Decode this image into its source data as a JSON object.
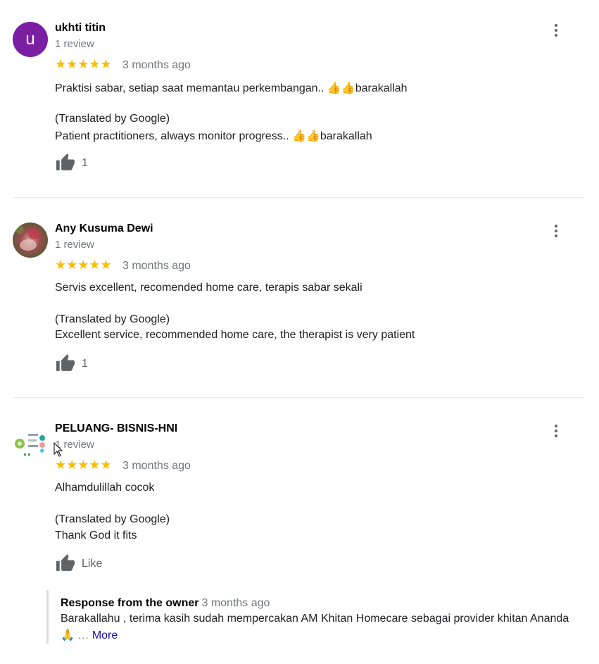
{
  "reviews": [
    {
      "name": "ukhti titin",
      "avatar_letter": "u",
      "review_count": "1 review",
      "stars": "★★★★★",
      "date": "3 months ago",
      "original": "Praktisi sabar, setiap saat memantau perkembangan.. 👍👍barakallah",
      "translated_label": "(Translated by Google)",
      "translated": "Patient practitioners, always monitor progress.. 👍👍barakallah",
      "likes": "1"
    },
    {
      "name": "Any Kusuma Dewi",
      "review_count": "1 review",
      "stars": "★★★★★",
      "date": "3 months ago",
      "original": "Servis excellent, recomended home care, terapis sabar sekali",
      "translated_label": "(Translated by Google)",
      "translated": "Excellent service, recommended home care, the therapist is very patient",
      "likes": "1"
    },
    {
      "name": "PELUANG- BISNIS-HNI",
      "review_count": "1 review",
      "stars": "★★★★★",
      "date": "3 months ago",
      "original": "Alhamdulillah cocok",
      "translated_label": "(Translated by Google)",
      "translated": "Thank God it fits",
      "likes": "Like"
    }
  ],
  "owner_response": {
    "title": "Response from the owner",
    "date": "3 months ago",
    "text": "Barakallahu , terima kasih sudah mempercakan AM Khitan Homecare sebagai provider khitan Ananda",
    "emoji": "🙏",
    "ellipsis": "…",
    "more": "More"
  },
  "colors": {
    "star": "#fbbc04",
    "avatar_purple": "#7b1fa2",
    "link": "#1a0dab"
  }
}
